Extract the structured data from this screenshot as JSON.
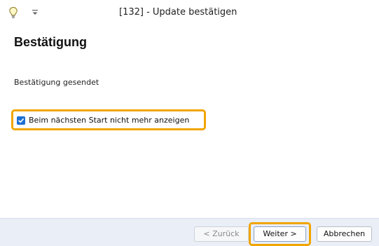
{
  "window": {
    "title": "[132] - Update bestätigen",
    "app_icon": "lightbulb-icon",
    "quick_access_icon": "quick-access-dropdown-icon"
  },
  "content": {
    "heading": "Bestätigung",
    "status": "Bestätigung gesendet",
    "checkbox": {
      "label": "Beim nächsten Start nicht mehr anzeigen",
      "checked": true
    }
  },
  "footer": {
    "back_label": "< Zurück",
    "next_label": "Weiter >",
    "cancel_label": "Abbrechen"
  },
  "colors": {
    "highlight": "#f0a500",
    "checkbox_accent": "#1e6fd0",
    "footer_bg": "#e9eef7"
  }
}
